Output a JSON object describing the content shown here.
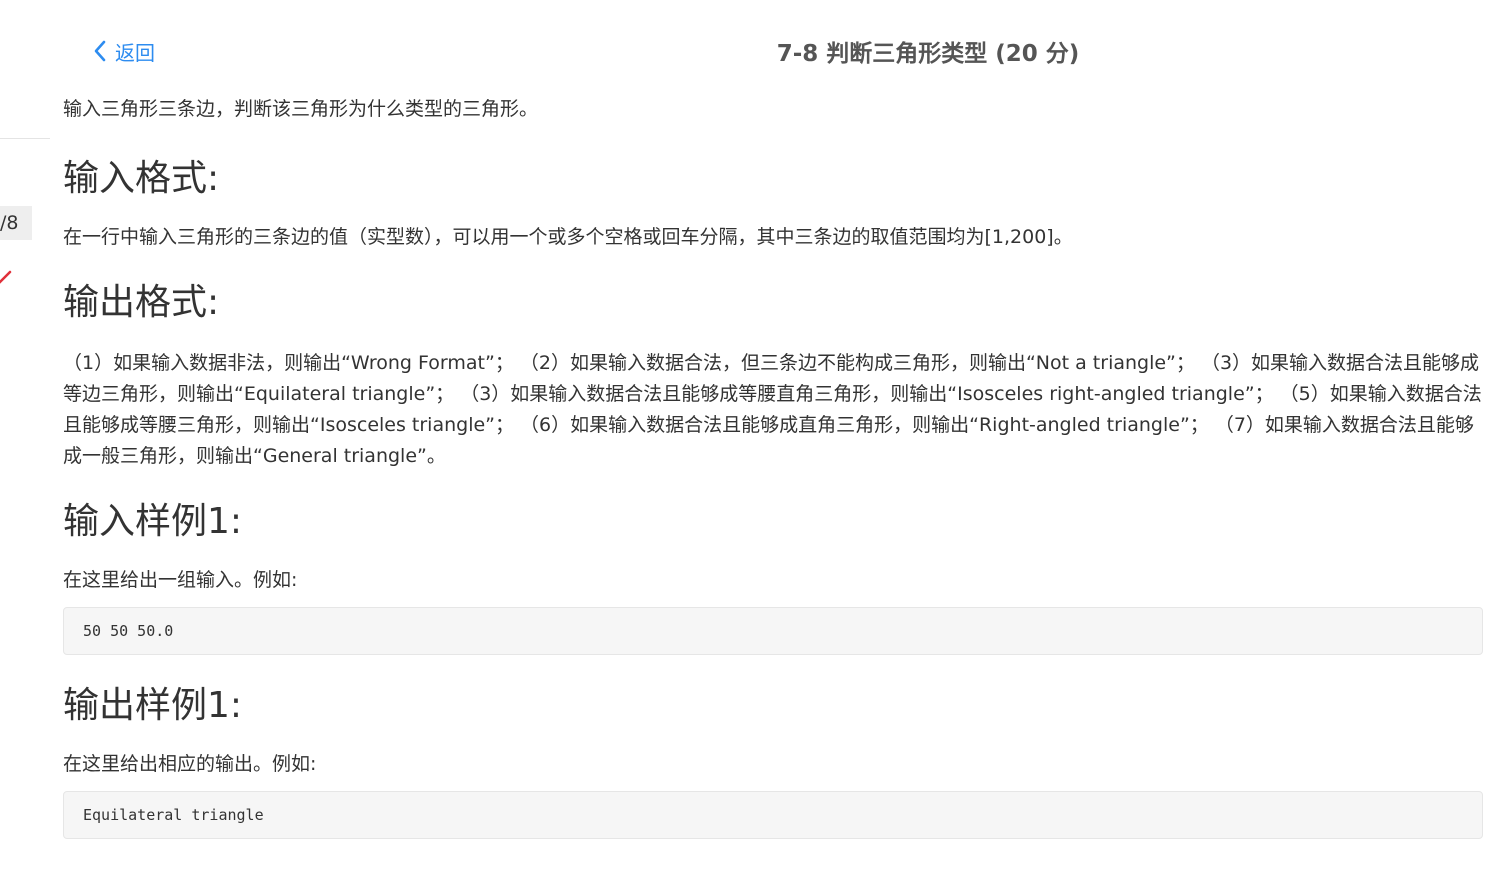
{
  "rail": {
    "page_indicator": "/8"
  },
  "header": {
    "back_label": "返回",
    "title": "7-8 判断三角形类型 (20 分)"
  },
  "problem": {
    "intro": "输入三角形三条边，判断该三角形为什么类型的三角形。",
    "input_format_heading": "输入格式:",
    "input_format_text": "在一行中输入三角形的三条边的值（实型数），可以用一个或多个空格或回车分隔，其中三条边的取值范围均为[1,200]。",
    "output_format_heading": "输出格式:",
    "output_format_text": "（1）如果输入数据非法，则输出“Wrong Format”；  （2）如果输入数据合法，但三条边不能构成三角形，则输出“Not a triangle”；  （3）如果输入数据合法且能够成等边三角形，则输出“Equilateral triangle”；  （3）如果输入数据合法且能够成等腰直角三角形，则输出“Isosceles right-angled triangle”；  （5）如果输入数据合法且能够成等腰三角形，则输出“Isosceles triangle”；  （6）如果输入数据合法且能够成直角三角形，则输出“Right-angled triangle”；  （7）如果输入数据合法且能够成一般三角形，则输出“General triangle”。",
    "sample_input_heading": "输入样例1:",
    "sample_input_desc": "在这里给出一组输入。例如:",
    "sample_input_code": "50 50 50.0",
    "sample_output_heading": "输出样例1:",
    "sample_output_desc": "在这里给出相应的输出。例如:",
    "sample_output_code": "Equilateral triangle"
  },
  "colors": {
    "link": "#2d8cf0",
    "title": "#555555",
    "text": "#333333",
    "code_bg": "#f6f6f6",
    "mark": "#e0303a"
  },
  "icons": {
    "back": "chevron-left-icon",
    "rail_mark": "check-mark-icon"
  }
}
